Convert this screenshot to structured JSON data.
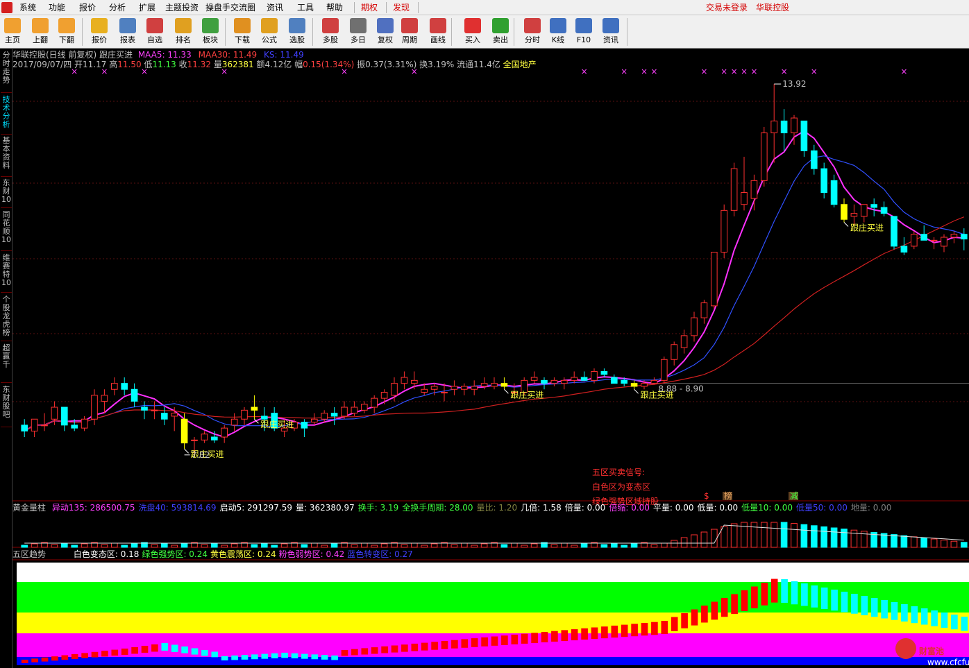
{
  "menu": {
    "items": [
      "系统",
      "功能",
      "报价",
      "分析",
      "扩展",
      "主题投资",
      "操盘手交流圈",
      "资讯",
      "工具",
      "帮助"
    ],
    "special": [
      "期权",
      "发现"
    ],
    "right": [
      "交易未登录",
      "华联控股"
    ]
  },
  "toolbar": {
    "buttons": [
      {
        "label": "主页",
        "icon": "home-icon",
        "color": "#f0a030"
      },
      {
        "label": "上翻",
        "icon": "arrow-up-icon",
        "color": "#f0a030"
      },
      {
        "label": "下翻",
        "icon": "arrow-down-icon",
        "color": "#f0a030"
      },
      {
        "label": "报价",
        "icon": "yuan-icon",
        "color": "#e8b020"
      },
      {
        "label": "报表",
        "icon": "report-icon",
        "color": "#5080c0"
      },
      {
        "label": "自选",
        "icon": "f6-icon",
        "color": "#d04040"
      },
      {
        "label": "排名",
        "icon": "rank-icon",
        "color": "#e0a020"
      },
      {
        "label": "板块",
        "icon": "grid-icon",
        "color": "#40a040"
      },
      {
        "label": "下载",
        "icon": "download-icon",
        "color": "#e09020"
      },
      {
        "label": "公式",
        "icon": "formula-icon",
        "color": "#e0a020"
      },
      {
        "label": "选股",
        "icon": "select-stock-icon",
        "color": "#5080c0"
      },
      {
        "label": "多股",
        "icon": "multi-stock-icon",
        "color": "#d04040"
      },
      {
        "label": "多日",
        "icon": "clock-icon",
        "color": "#707070"
      },
      {
        "label": "复权",
        "icon": "restore-icon",
        "color": "#5070c0"
      },
      {
        "label": "周期",
        "icon": "f8-icon",
        "color": "#d04040"
      },
      {
        "label": "画线",
        "icon": "draw-line-icon",
        "color": "#d04040"
      },
      {
        "label": "买入",
        "icon": "buy-icon",
        "color": "#e03030"
      },
      {
        "label": "卖出",
        "icon": "sell-icon",
        "color": "#30a030"
      },
      {
        "label": "分时",
        "icon": "timeshare-icon",
        "color": "#d04040"
      },
      {
        "label": "K线",
        "icon": "kline-icon",
        "color": "#4070c0"
      },
      {
        "label": "F10",
        "icon": "f10-icon",
        "color": "#4070c0"
      },
      {
        "label": "资讯",
        "icon": "news-icon",
        "color": "#4070c0"
      }
    ]
  },
  "side_tabs": [
    "分时走势",
    "技术分析",
    "基本资料",
    "东财10",
    "同花顺10",
    "维赛特10",
    "个股龙虎榜",
    "超赢千",
    "东财股吧"
  ],
  "chart_header": {
    "title": "华联控股(日线 前复权) 跟庄买进",
    "ma5": "MAA5: 11.33",
    "ma30": "MAA30: 11.49",
    "ks": "KS: 11.49"
  },
  "quote": {
    "date": "2017/09/07/四",
    "open": "开11.17",
    "high_label": "高",
    "high": "11.50",
    "low_label": "低",
    "low": "11.13",
    "close_label": "收",
    "close": "11.32",
    "vol_label": "量",
    "vol": "362381",
    "amt": "额4.12亿",
    "pct_label": "幅",
    "pct": "0.15(1.34%)",
    "swing": "振0.37(3.31%)",
    "turnover": "换3.19%",
    "float": "流通11.4亿",
    "sector": "全国地产"
  },
  "chart_data": {
    "type": "candlestick",
    "y_range": [
      7.0,
      14.2
    ],
    "candles": [
      [
        8.2,
        8.3,
        8.0,
        8.1
      ],
      [
        8.1,
        8.3,
        8.0,
        8.3
      ],
      [
        8.2,
        8.4,
        8.1,
        8.2
      ],
      [
        8.3,
        8.6,
        8.2,
        8.5
      ],
      [
        8.5,
        8.5,
        8.1,
        8.2
      ],
      [
        8.2,
        8.3,
        8.1,
        8.15
      ],
      [
        8.15,
        8.35,
        8.1,
        8.3
      ],
      [
        8.3,
        8.8,
        8.2,
        8.7
      ],
      [
        8.6,
        8.8,
        8.4,
        8.7
      ],
      [
        8.8,
        9.0,
        8.7,
        8.9
      ],
      [
        8.9,
        9.0,
        8.7,
        8.8
      ],
      [
        8.8,
        8.9,
        8.5,
        8.6
      ],
      [
        8.5,
        8.6,
        8.3,
        8.45
      ],
      [
        8.45,
        8.6,
        8.3,
        8.45
      ],
      [
        8.4,
        8.5,
        8.2,
        8.3
      ],
      [
        8.35,
        8.5,
        8.1,
        8.4
      ],
      [
        8.3,
        8.4,
        7.8,
        7.9
      ],
      [
        7.95,
        8.0,
        7.7,
        7.95
      ],
      [
        7.95,
        8.1,
        7.9,
        8.05
      ],
      [
        8.0,
        8.1,
        7.9,
        7.95
      ],
      [
        8.0,
        8.2,
        7.9,
        8.15
      ],
      [
        8.2,
        8.4,
        8.1,
        8.3
      ],
      [
        8.3,
        8.5,
        8.2,
        8.45
      ],
      [
        8.5,
        8.7,
        8.3,
        8.45
      ],
      [
        8.35,
        8.5,
        8.1,
        8.3
      ],
      [
        8.4,
        8.5,
        8.1,
        8.15
      ],
      [
        8.1,
        8.3,
        8.0,
        8.15
      ],
      [
        8.15,
        8.3,
        8.1,
        8.25
      ],
      [
        8.25,
        8.3,
        8.0,
        8.15
      ],
      [
        8.25,
        8.4,
        8.2,
        8.3
      ],
      [
        8.3,
        8.45,
        8.25,
        8.4
      ],
      [
        8.4,
        8.5,
        8.2,
        8.35
      ],
      [
        8.35,
        8.6,
        8.3,
        8.5
      ],
      [
        8.4,
        8.6,
        8.35,
        8.5
      ],
      [
        8.45,
        8.6,
        8.4,
        8.55
      ],
      [
        8.5,
        8.7,
        8.4,
        8.65
      ],
      [
        8.65,
        8.8,
        8.55,
        8.75
      ],
      [
        8.7,
        9.0,
        8.6,
        8.9
      ],
      [
        8.9,
        9.1,
        8.8,
        9.0
      ],
      [
        8.9,
        9.1,
        8.8,
        8.95
      ],
      [
        8.75,
        8.9,
        8.7,
        8.8
      ],
      [
        8.8,
        8.9,
        8.7,
        8.85
      ],
      [
        8.75,
        8.9,
        8.6,
        8.75
      ],
      [
        8.8,
        8.95,
        8.7,
        8.85
      ],
      [
        8.8,
        8.9,
        8.7,
        8.85
      ],
      [
        8.8,
        8.95,
        8.7,
        8.85
      ],
      [
        8.85,
        9.0,
        8.8,
        8.9
      ],
      [
        8.85,
        9.0,
        8.8,
        8.9
      ],
      [
        8.9,
        9.0,
        8.8,
        8.85
      ],
      [
        8.75,
        8.9,
        8.7,
        8.75
      ],
      [
        8.75,
        9.0,
        8.7,
        8.95
      ],
      [
        8.95,
        9.1,
        8.9,
        9.0
      ],
      [
        8.95,
        9.0,
        8.8,
        8.9
      ],
      [
        8.9,
        9.0,
        8.85,
        8.95
      ],
      [
        8.9,
        9.0,
        8.8,
        8.95
      ],
      [
        8.95,
        9.1,
        8.9,
        9.0
      ],
      [
        9.0,
        9.1,
        8.95,
        8.95
      ],
      [
        8.95,
        9.15,
        8.9,
        9.1
      ],
      [
        9.1,
        9.15,
        9.0,
        9.05
      ],
      [
        9.0,
        9.05,
        8.9,
        8.9
      ],
      [
        8.95,
        9.0,
        8.85,
        8.9
      ],
      [
        8.9,
        8.95,
        8.8,
        8.85
      ],
      [
        8.85,
        8.95,
        8.8,
        8.9
      ],
      [
        8.9,
        9.0,
        8.88,
        8.95
      ],
      [
        8.95,
        9.35,
        8.9,
        9.3
      ],
      [
        9.3,
        9.6,
        9.2,
        9.55
      ],
      [
        9.5,
        9.8,
        9.4,
        9.7
      ],
      [
        9.7,
        10.1,
        9.6,
        10.0
      ],
      [
        10.0,
        10.3,
        9.9,
        10.25
      ],
      [
        10.2,
        11.1,
        10.15,
        11.1
      ],
      [
        11.1,
        11.9,
        11.0,
        11.8
      ],
      [
        11.8,
        12.6,
        11.7,
        12.5
      ],
      [
        11.9,
        12.7,
        11.8,
        12.1
      ],
      [
        12.0,
        12.4,
        11.8,
        12.3
      ],
      [
        12.3,
        13.2,
        12.2,
        13.1
      ],
      [
        13.1,
        13.92,
        12.6,
        13.3
      ],
      [
        13.3,
        13.5,
        12.8,
        13.1
      ],
      [
        13.1,
        13.4,
        12.9,
        13.35
      ],
      [
        13.3,
        13.3,
        12.7,
        12.8
      ],
      [
        12.8,
        12.9,
        12.4,
        12.5
      ],
      [
        12.5,
        12.6,
        12.0,
        12.1
      ],
      [
        12.3,
        12.4,
        11.85,
        11.9
      ],
      [
        11.9,
        12.0,
        11.6,
        11.65
      ],
      [
        11.7,
        11.9,
        11.55,
        11.75
      ],
      [
        11.7,
        11.9,
        11.6,
        11.9
      ],
      [
        11.9,
        12.0,
        11.7,
        11.85
      ],
      [
        11.85,
        11.95,
        11.7,
        11.75
      ],
      [
        11.7,
        11.7,
        11.15,
        11.2
      ],
      [
        11.2,
        11.35,
        11.05,
        11.1
      ],
      [
        11.2,
        11.45,
        11.15,
        11.4
      ],
      [
        11.4,
        11.55,
        11.3,
        11.3
      ],
      [
        11.3,
        11.35,
        11.15,
        11.3
      ],
      [
        11.2,
        11.4,
        11.1,
        11.35
      ],
      [
        11.35,
        11.45,
        11.25,
        11.4
      ],
      [
        11.4,
        11.5,
        11.13,
        11.32
      ]
    ],
    "ma5_line": "magenta",
    "ma30_line": "blue",
    "ks_line": "red",
    "markers": [
      {
        "idx": 16,
        "text": "跟庄买进"
      },
      {
        "idx": 23,
        "text": "跟庄买进"
      },
      {
        "idx": 48,
        "text": "跟庄买进"
      },
      {
        "idx": 61,
        "text": "跟庄买进"
      },
      {
        "idx": 82,
        "text": "跟庄买进"
      }
    ],
    "annotations": {
      "high": "13.92",
      "low": "7.82",
      "range": "8.88 - 8.90"
    },
    "signal_text": [
      "五区买卖信号:",
      "白色区为变态区",
      "绿色强势区域持股"
    ],
    "mini_labels": [
      "$",
      "榜",
      "减"
    ]
  },
  "volume_panel": {
    "title": "黄金量柱",
    "items": [
      {
        "k": "异动135:",
        "v": "286500.75",
        "c": "#ff40ff"
      },
      {
        "k": "洗盘40:",
        "v": "593814.69",
        "c": "#4040ff"
      },
      {
        "k": "启动5:",
        "v": "291297.59",
        "c": "#ffffff"
      },
      {
        "k": "量:",
        "v": "362380.97",
        "c": "#ffffff"
      },
      {
        "k": "换手:",
        "v": "3.19",
        "c": "#40ff40"
      },
      {
        "k": "全换手周期:",
        "v": "28.00",
        "c": "#40ff40"
      },
      {
        "k": "量比:",
        "v": "1.20",
        "c": "#808040"
      },
      {
        "k": "几倍:",
        "v": "1.58",
        "c": "#ffffff"
      },
      {
        "k": "倍量:",
        "v": "0.00",
        "c": "#ffffff"
      },
      {
        "k": "倍缩:",
        "v": "0.00",
        "c": "#ff40ff"
      },
      {
        "k": "平量:",
        "v": "0.00",
        "c": "#ffffff"
      },
      {
        "k": "低量:",
        "v": "0.00",
        "c": "#ffffff"
      },
      {
        "k": "低量10:",
        "v": "0.00",
        "c": "#40ff40"
      },
      {
        "k": "低量50:",
        "v": "0.00",
        "c": "#4040ff"
      },
      {
        "k": "地量:",
        "v": "0.00",
        "c": "#808080"
      }
    ]
  },
  "zone_panel": {
    "title": "五区趋势",
    "items": [
      {
        "k": "白色变态区:",
        "v": "0.18",
        "c": "#ffffff"
      },
      {
        "k": "绿色强势区:",
        "v": "0.24",
        "c": "#40ff40"
      },
      {
        "k": "黄色震荡区:",
        "v": "0.24",
        "c": "#ffff40"
      },
      {
        "k": "粉色弱势区:",
        "v": "0.42",
        "c": "#ff40ff"
      },
      {
        "k": "蓝色转变区:",
        "v": "0.27",
        "c": "#4040ff"
      }
    ]
  },
  "watermark": {
    "text": "财富池",
    "url": "www.cfcfu.com"
  }
}
